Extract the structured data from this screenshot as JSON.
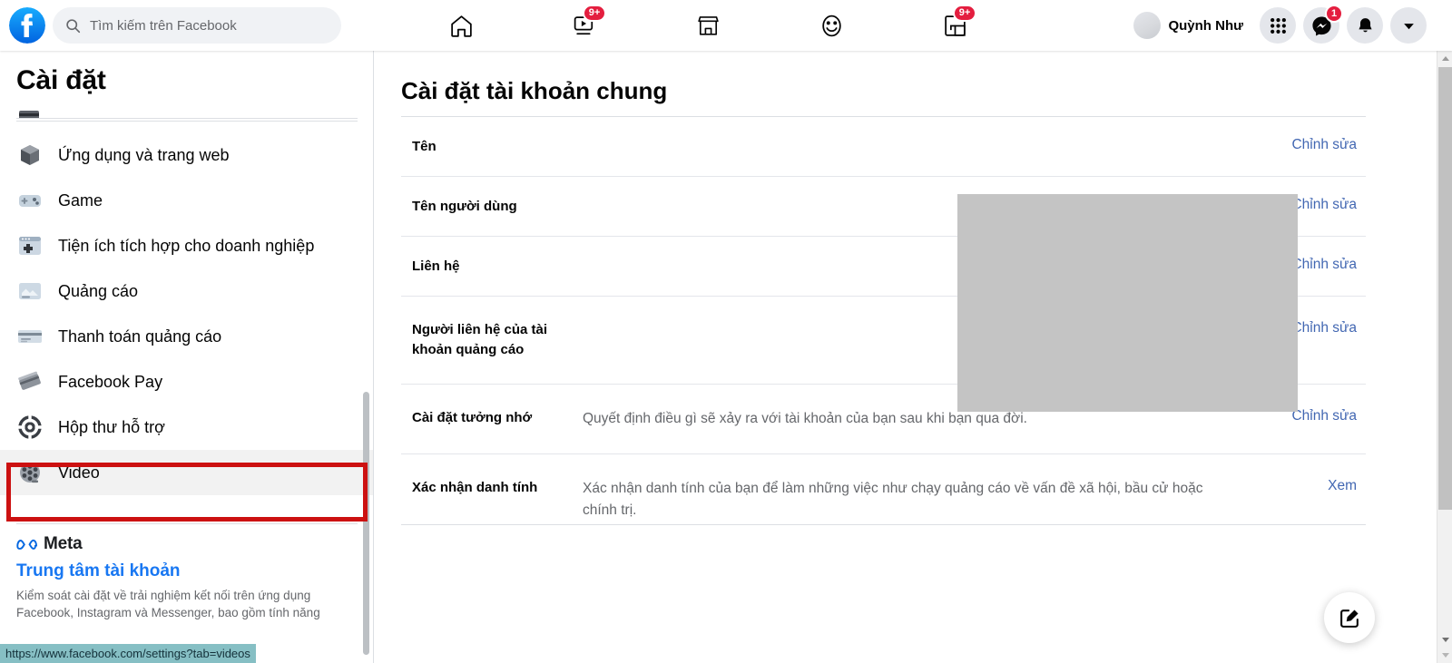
{
  "header": {
    "logo_icon": "facebook-logo-icon",
    "search": {
      "icon": "search-icon",
      "placeholder": "Tìm kiếm trên Facebook",
      "value": ""
    },
    "nav": [
      {
        "name": "home",
        "icon": "home-icon",
        "badge": ""
      },
      {
        "name": "watch",
        "icon": "video-play-icon",
        "badge": "9+"
      },
      {
        "name": "marketplace",
        "icon": "store-icon",
        "badge": ""
      },
      {
        "name": "groups",
        "icon": "groups-icon",
        "badge": ""
      },
      {
        "name": "gaming",
        "icon": "gaming-icon",
        "badge": "9+"
      }
    ],
    "profile_name": "Quỳnh Như",
    "menu_icon": "grid-menu-icon",
    "messenger_icon": "messenger-icon",
    "messenger_badge": "1",
    "notifications_icon": "bell-icon",
    "account_icon": "chevron-down-icon"
  },
  "sidebar": {
    "title": "Cài đặt",
    "items": [
      {
        "label": "Ứng dụng và trang web",
        "icon": "cube-icon"
      },
      {
        "label": "Game",
        "icon": "gamepad-icon"
      },
      {
        "label": "Tiện ích tích hợp cho doanh nghiệp",
        "icon": "business-integration-icon"
      },
      {
        "label": "Quảng cáo",
        "icon": "ads-icon"
      },
      {
        "label": "Thanh toán quảng cáo",
        "icon": "credit-card-icon"
      },
      {
        "label": "Facebook Pay",
        "icon": "cards-stack-icon"
      },
      {
        "label": "Hộp thư hỗ trợ",
        "icon": "life-ring-icon"
      },
      {
        "label": "Video",
        "icon": "film-reel-icon"
      }
    ],
    "active_item": "Video",
    "footer": {
      "meta_label": "Meta",
      "meta_icon": "meta-infinity-icon",
      "account_center_link": "Trung tâm tài khoản",
      "description": "Kiểm soát cài đặt về trải nghiệm kết nối trên ứng dụng Facebook, Instagram và Messenger, bao gồm tính năng"
    }
  },
  "status_bar": {
    "url": "https://www.facebook.com/settings?tab=videos"
  },
  "main": {
    "title": "Cài đặt tài khoản chung",
    "rows": [
      {
        "label": "Tên",
        "value": "",
        "action": "Chỉnh sửa"
      },
      {
        "label": "Tên người dùng",
        "value": "",
        "action": "Chỉnh sửa"
      },
      {
        "label": "Liên hệ",
        "value": "",
        "action": "Chỉnh sửa"
      },
      {
        "label": "Người liên hệ của tài khoản quảng cáo",
        "value": "",
        "action": "Chỉnh sửa"
      },
      {
        "label": "Cài đặt tưởng nhớ",
        "value": "Quyết định điều gì sẽ xảy ra với tài khoản của bạn sau khi bạn qua đời.",
        "action": "Chỉnh sửa"
      },
      {
        "label": "Xác nhận danh tính",
        "value": "Xác nhận danh tính của bạn để làm những việc như chạy quảng cáo về vấn đề xã hội, bầu cử hoặc chính trị.",
        "action": "Xem"
      }
    ],
    "compose_icon": "compose-pencil-icon"
  },
  "annotation": {
    "type": "highlight-rectangle",
    "target": "Video",
    "color": "#cc1111"
  },
  "colors": {
    "brand_blue": "#1877f2",
    "link_blue": "#4267b2",
    "badge_red": "#e41e3f",
    "annotation_red": "#cc1111",
    "redaction_gray": "#c4c4c4",
    "status_bar_teal": "#86bfc4"
  }
}
